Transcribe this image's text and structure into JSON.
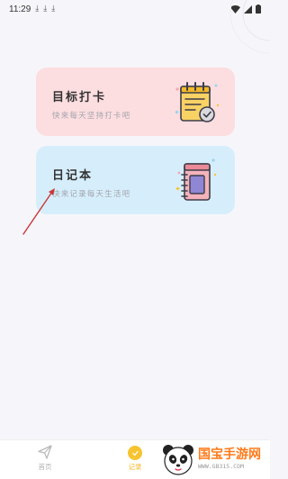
{
  "status_bar": {
    "time": "11:29",
    "download_glyph": "⤓"
  },
  "cards": {
    "goal": {
      "title": "目标打卡",
      "subtitle": "快来每天坚持打卡吧",
      "icon": "checklist-calendar-icon"
    },
    "diary": {
      "title": "日记本",
      "subtitle": "快来记录每天生活吧",
      "icon": "notebook-icon"
    }
  },
  "bottom_nav": {
    "items": [
      {
        "label": "首页",
        "icon": "paper-plane-icon",
        "active": false
      },
      {
        "label": "记录",
        "icon": "record-icon",
        "active": true
      }
    ]
  },
  "watermark": {
    "brand": "国宝手游网",
    "url": "WWW.GB315.COM"
  },
  "colors": {
    "goal_card": "#fcdde0",
    "diary_card": "#d6eefb",
    "accent_yellow": "#f6c431",
    "annotation_red": "#c8383a"
  }
}
